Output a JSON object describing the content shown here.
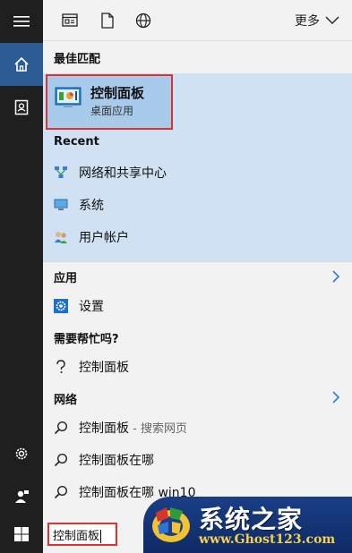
{
  "topbar": {
    "more_label": "更多"
  },
  "best_match": {
    "header": "最佳匹配",
    "title": "控制面板",
    "subtitle": "桌面应用"
  },
  "recent": {
    "header": "Recent",
    "items": [
      {
        "label": "网络和共享中心",
        "icon": "network-center-icon"
      },
      {
        "label": "系统",
        "icon": "monitor-icon"
      },
      {
        "label": "用户帐户",
        "icon": "users-icon"
      }
    ]
  },
  "apps": {
    "header": "应用",
    "items": [
      {
        "label": "设置",
        "icon": "gear-icon"
      }
    ]
  },
  "help": {
    "header": "需要帮忙吗?",
    "items": [
      {
        "label": "控制面板",
        "icon": "question-icon"
      }
    ]
  },
  "web": {
    "header": "网络",
    "items": [
      {
        "label": "控制面板",
        "suffix": " - 搜索网页"
      },
      {
        "label": "控制面板在哪",
        "suffix": ""
      },
      {
        "label": "控制面板在哪 win10",
        "suffix": ""
      }
    ]
  },
  "search": {
    "query": "控制面板"
  },
  "watermark": {
    "title": "系统之家",
    "url": "www.Ghost123.com"
  },
  "colors": {
    "rail": "#1f1f1f",
    "rail_active": "#2b5c93",
    "panel": "#f2f2f2",
    "best_area": "#cfe1f2",
    "best_selected": "#a9cbeb",
    "highlight_box": "#e23030"
  }
}
